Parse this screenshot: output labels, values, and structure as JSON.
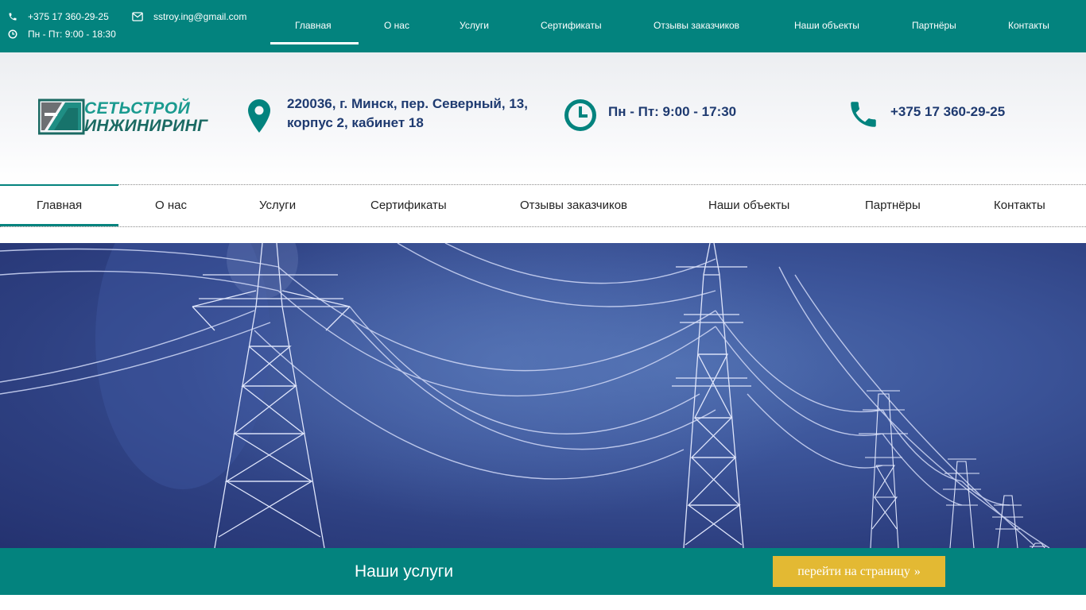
{
  "topbar": {
    "phone": "+375 17 360-29-25",
    "email": "sstroy.ing@gmail.com",
    "hours": "Пн - Пт: 9:00 - 18:30",
    "nav": [
      {
        "label": "Главная",
        "active": true
      },
      {
        "label": "О нас"
      },
      {
        "label": "Услуги"
      },
      {
        "label": "Сертификаты"
      },
      {
        "label": "Отзывы заказчиков"
      },
      {
        "label": "Наши объекты"
      },
      {
        "label": "Партнёры"
      },
      {
        "label": "Контакты"
      }
    ]
  },
  "header": {
    "logo_line1": "СЕТЬСТРОЙ",
    "logo_line2": "ИНЖИНИРИНГ",
    "address_line1": "220036, г. Минск, пер. Северный, 13,",
    "address_line2": "корпус 2, кабинет 18",
    "hours": "Пн - Пт: 9:00 - 17:30",
    "phone": "+375 17 360-29-25"
  },
  "mainnav": [
    {
      "label": "Главная",
      "active": true
    },
    {
      "label": "О нас"
    },
    {
      "label": "Услуги"
    },
    {
      "label": "Сертификаты"
    },
    {
      "label": "Отзывы заказчиков"
    },
    {
      "label": "Наши объекты"
    },
    {
      "label": "Партнёры"
    },
    {
      "label": "Контакты"
    }
  ],
  "services_strip": {
    "title": "Наши услуги",
    "button_label": "перейти на страницу",
    "button_icon": "»"
  },
  "colors": {
    "brand_teal": "#03837e",
    "text_navy": "#1e3a70",
    "button_gold": "#e3b933"
  },
  "icons": {
    "topbar_phone": "phone-icon",
    "topbar_email": "envelope-icon",
    "topbar_hours": "clock-icon",
    "header_address": "map-marker-icon",
    "header_hours": "clock-icon",
    "header_phone": "phone-icon"
  }
}
